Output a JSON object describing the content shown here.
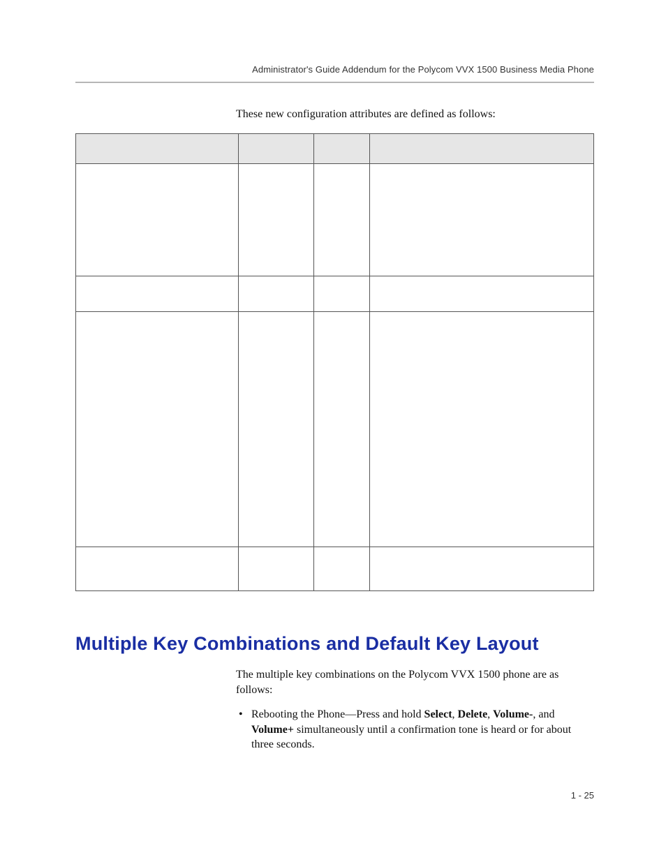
{
  "header": {
    "running_title": "Administrator's Guide Addendum for the Polycom VVX 1500 Business Media Phone"
  },
  "intro": "These new configuration attributes are defined as follows:",
  "table": {
    "headers": [
      "",
      "",
      "",
      ""
    ],
    "rows": [
      [
        "",
        "",
        "",
        ""
      ],
      [
        "",
        "",
        "",
        ""
      ],
      [
        "",
        "",
        "",
        ""
      ],
      [
        "",
        "",
        "",
        ""
      ]
    ]
  },
  "section": {
    "heading": "Multiple Key Combinations and Default Key Layout",
    "para1": "The multiple key combinations on the Polycom VVX 1500 phone are as follows:",
    "bullet1_prefix": "Rebooting the Phone—Press and hold ",
    "kw_select": "Select",
    "sep1": ", ",
    "kw_delete": "Delete",
    "sep2": ", ",
    "kw_volminus": "Volume-",
    "sep3": ", and ",
    "kw_volplus": "Volume+",
    "bullet1_suffix": " simultaneously until a confirmation tone is heard or for about three seconds."
  },
  "footer": {
    "page_number": "1 - 25"
  }
}
